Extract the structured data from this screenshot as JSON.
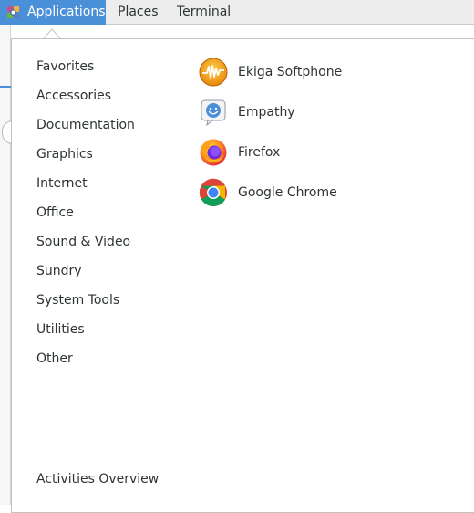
{
  "topbar": {
    "applications_label": "Applications",
    "places_label": "Places",
    "terminal_label": "Terminal"
  },
  "menu": {
    "categories": [
      {
        "label": "Favorites"
      },
      {
        "label": "Accessories"
      },
      {
        "label": "Documentation"
      },
      {
        "label": "Graphics"
      },
      {
        "label": "Internet"
      },
      {
        "label": "Office"
      },
      {
        "label": "Sound & Video"
      },
      {
        "label": "Sundry"
      },
      {
        "label": "System Tools"
      },
      {
        "label": "Utilities"
      },
      {
        "label": "Other"
      }
    ],
    "apps": [
      {
        "label": "Ekiga Softphone",
        "icon": "ekiga-icon"
      },
      {
        "label": "Empathy",
        "icon": "empathy-icon"
      },
      {
        "label": "Firefox",
        "icon": "firefox-icon"
      },
      {
        "label": "Google Chrome",
        "icon": "chrome-icon"
      }
    ],
    "footer_label": "Activities Overview"
  },
  "colors": {
    "accent": "#4a90d9",
    "panel_bg": "#ededed",
    "text": "#2e3436"
  }
}
